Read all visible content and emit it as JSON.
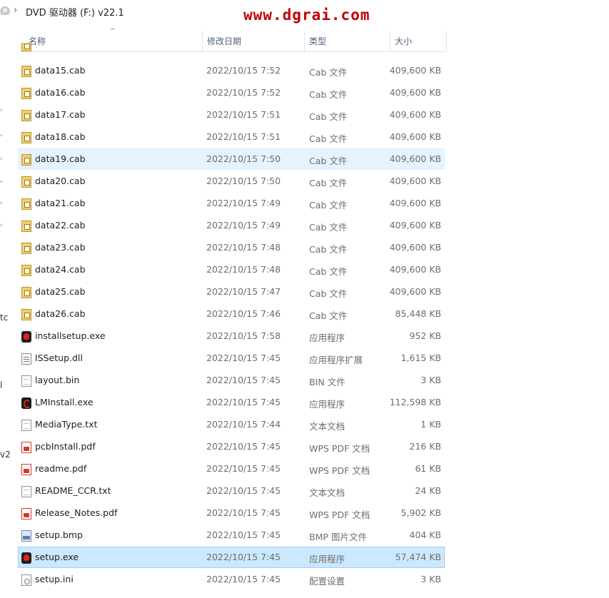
{
  "window": {
    "breadcrumb_separator": "›",
    "breadcrumb": "DVD 驱动器 (F:) v22.1",
    "watermark": "www.dgrai.com"
  },
  "columns": {
    "name": "名称",
    "date": "修改日期",
    "type": "类型",
    "size": "大小",
    "sort_indicator": "^"
  },
  "nav_pane_fragments": [
    "tc",
    "l",
    "v2"
  ],
  "files": [
    {
      "name": "data15.cab",
      "date": "2022/10/15 7:52",
      "type": "Cab 文件",
      "size": "409,600 KB",
      "icon": "cab-file-icon"
    },
    {
      "name": "data16.cab",
      "date": "2022/10/15 7:52",
      "type": "Cab 文件",
      "size": "409,600 KB",
      "icon": "cab-file-icon"
    },
    {
      "name": "data17.cab",
      "date": "2022/10/15 7:51",
      "type": "Cab 文件",
      "size": "409,600 KB",
      "icon": "cab-file-icon"
    },
    {
      "name": "data18.cab",
      "date": "2022/10/15 7:51",
      "type": "Cab 文件",
      "size": "409,600 KB",
      "icon": "cab-file-icon"
    },
    {
      "name": "data19.cab",
      "date": "2022/10/15 7:50",
      "type": "Cab 文件",
      "size": "409,600 KB",
      "icon": "cab-file-icon",
      "state": "hover"
    },
    {
      "name": "data20.cab",
      "date": "2022/10/15 7:50",
      "type": "Cab 文件",
      "size": "409,600 KB",
      "icon": "cab-file-icon"
    },
    {
      "name": "data21.cab",
      "date": "2022/10/15 7:49",
      "type": "Cab 文件",
      "size": "409,600 KB",
      "icon": "cab-file-icon"
    },
    {
      "name": "data22.cab",
      "date": "2022/10/15 7:49",
      "type": "Cab 文件",
      "size": "409,600 KB",
      "icon": "cab-file-icon"
    },
    {
      "name": "data23.cab",
      "date": "2022/10/15 7:48",
      "type": "Cab 文件",
      "size": "409,600 KB",
      "icon": "cab-file-icon"
    },
    {
      "name": "data24.cab",
      "date": "2022/10/15 7:48",
      "type": "Cab 文件",
      "size": "409,600 KB",
      "icon": "cab-file-icon"
    },
    {
      "name": "data25.cab",
      "date": "2022/10/15 7:47",
      "type": "Cab 文件",
      "size": "409,600 KB",
      "icon": "cab-file-icon"
    },
    {
      "name": "data26.cab",
      "date": "2022/10/15 7:46",
      "type": "Cab 文件",
      "size": "85,448 KB",
      "icon": "cab-file-icon"
    },
    {
      "name": "installsetup.exe",
      "date": "2022/10/15 7:58",
      "type": "应用程序",
      "size": "952 KB",
      "icon": "exe-app-icon"
    },
    {
      "name": "ISSetup.dll",
      "date": "2022/10/15 7:45",
      "type": "应用程序扩展",
      "size": "1,615 KB",
      "icon": "dll-file-icon"
    },
    {
      "name": "layout.bin",
      "date": "2022/10/15 7:45",
      "type": "BIN 文件",
      "size": "3 KB",
      "icon": "generic-file-icon"
    },
    {
      "name": "LMInstall.exe",
      "date": "2022/10/15 7:45",
      "type": "应用程序",
      "size": "112,598 KB",
      "icon": "lm-app-icon"
    },
    {
      "name": "MediaType.txt",
      "date": "2022/10/15 7:44",
      "type": "文本文档",
      "size": "1 KB",
      "icon": "text-file-icon"
    },
    {
      "name": "pcbInstall.pdf",
      "date": "2022/10/15 7:45",
      "type": "WPS PDF 文档",
      "size": "216 KB",
      "icon": "pdf-file-icon"
    },
    {
      "name": "readme.pdf",
      "date": "2022/10/15 7:45",
      "type": "WPS PDF 文档",
      "size": "61 KB",
      "icon": "pdf-file-icon"
    },
    {
      "name": "README_CCR.txt",
      "date": "2022/10/15 7:45",
      "type": "文本文档",
      "size": "24 KB",
      "icon": "text-file-icon"
    },
    {
      "name": "Release_Notes.pdf",
      "date": "2022/10/15 7:45",
      "type": "WPS PDF 文档",
      "size": "5,902 KB",
      "icon": "pdf-file-icon"
    },
    {
      "name": "setup.bmp",
      "date": "2022/10/15 7:45",
      "type": "BMP 图片文件",
      "size": "404 KB",
      "icon": "bmp-image-icon"
    },
    {
      "name": "setup.exe",
      "date": "2022/10/15 7:45",
      "type": "应用程序",
      "size": "57,474 KB",
      "icon": "exe-app-icon",
      "state": "selected"
    },
    {
      "name": "setup.ini",
      "date": "2022/10/15 7:45",
      "type": "配置设置",
      "size": "3 KB",
      "icon": "ini-settings-icon"
    }
  ]
}
